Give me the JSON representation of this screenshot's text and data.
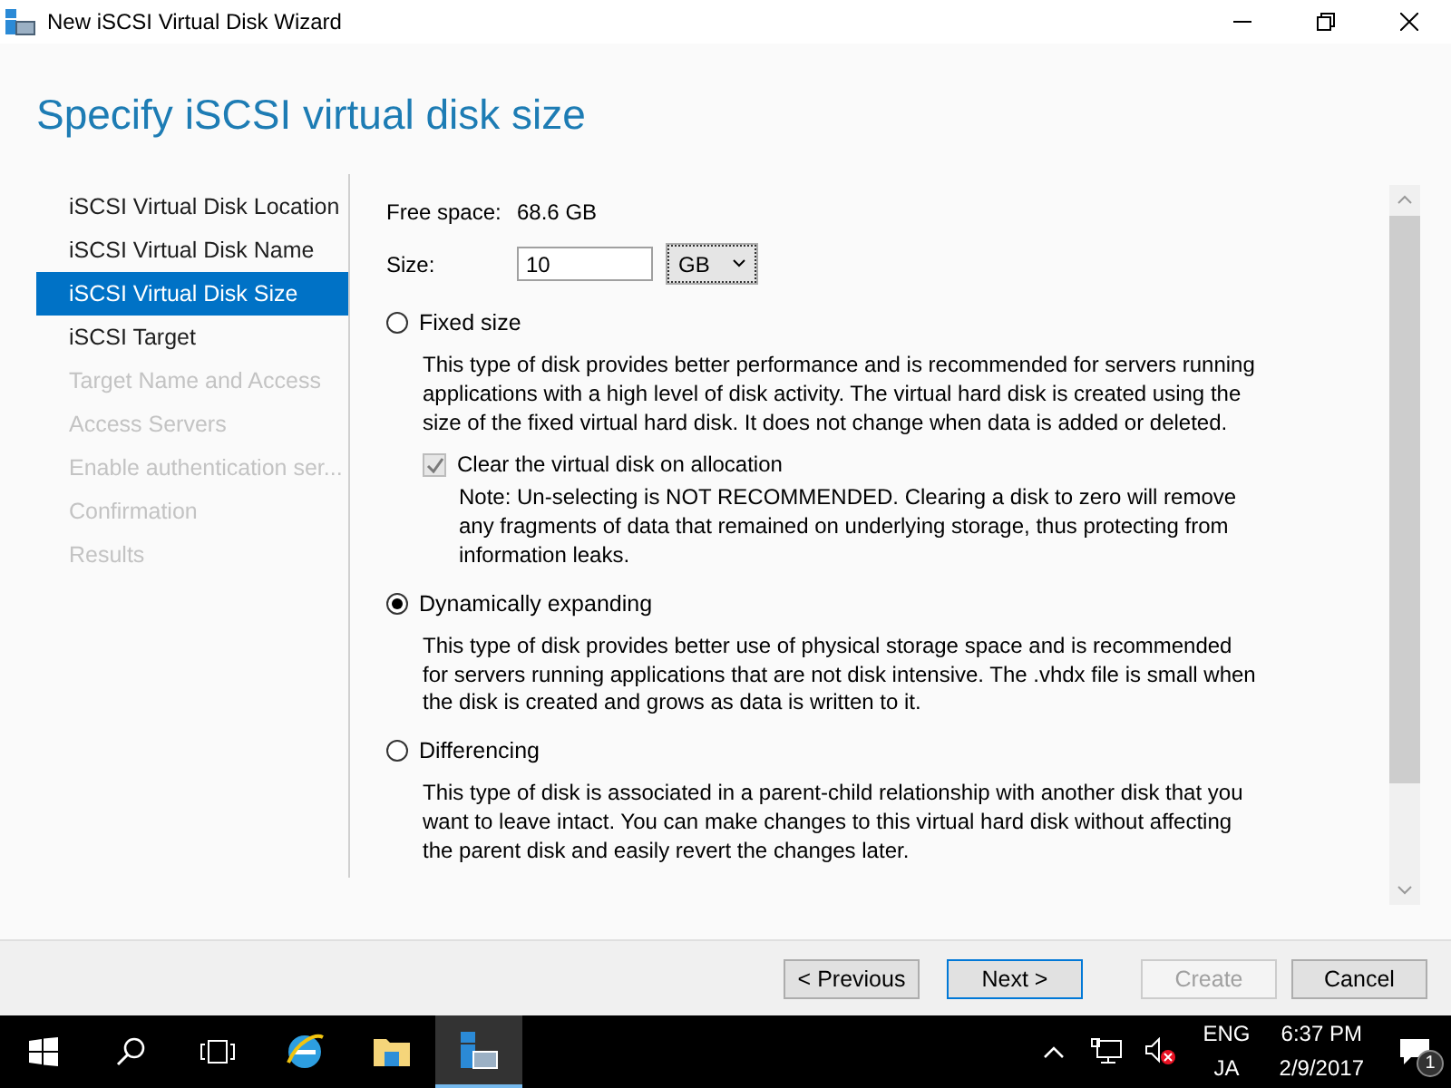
{
  "window": {
    "title": "New iSCSI Virtual Disk Wizard"
  },
  "heading": "Specify iSCSI virtual disk size",
  "steps": [
    {
      "label": "iSCSI Virtual Disk Location",
      "selected": false,
      "disabled": false
    },
    {
      "label": "iSCSI Virtual Disk Name",
      "selected": false,
      "disabled": false
    },
    {
      "label": "iSCSI Virtual Disk Size",
      "selected": true,
      "disabled": false
    },
    {
      "label": "iSCSI Target",
      "selected": false,
      "disabled": false
    },
    {
      "label": "Target Name and Access",
      "selected": false,
      "disabled": true
    },
    {
      "label": "Access Servers",
      "selected": false,
      "disabled": true
    },
    {
      "label": "Enable authentication ser...",
      "selected": false,
      "disabled": true
    },
    {
      "label": "Confirmation",
      "selected": false,
      "disabled": true
    },
    {
      "label": "Results",
      "selected": false,
      "disabled": true
    }
  ],
  "free_space": {
    "label": "Free space:",
    "value": "68.6 GB"
  },
  "size": {
    "label": "Size:",
    "value": "10",
    "unit": "GB"
  },
  "options": [
    {
      "label": "Fixed size",
      "selected": false,
      "description": "This type of disk provides better performance and is recommended for servers running applications with a high level of disk activity. The virtual hard disk is created using the size of the fixed virtual hard disk. It does not change when data is added or deleted.",
      "checkbox": {
        "label": "Clear the virtual disk on allocation",
        "checked": true,
        "disabled": true,
        "note": "Note: Un-selecting is NOT RECOMMENDED. Clearing a disk to zero will remove any fragments of data that remained on underlying storage, thus protecting from information leaks."
      }
    },
    {
      "label": "Dynamically expanding",
      "selected": true,
      "description": "This type of disk provides better use of physical storage space and is recommended for servers running applications that are not disk intensive. The .vhdx file is small when the disk is created and grows as data is written to it."
    },
    {
      "label": "Differencing",
      "selected": false,
      "description": "This type of disk is associated in a parent-child relationship with another disk that you want to leave intact. You can make changes to this virtual hard disk without affecting the parent disk and easily revert the changes later."
    }
  ],
  "buttons": [
    {
      "label": "< Previous",
      "disabled": false,
      "default": false
    },
    {
      "label": "Next >",
      "disabled": false,
      "default": true
    },
    {
      "label": "Create",
      "disabled": true,
      "default": false
    },
    {
      "label": "Cancel",
      "disabled": false,
      "default": false
    }
  ],
  "taskbar": {
    "language": "ENG",
    "input": "JA",
    "time": "6:37 PM",
    "date": "2/9/2017",
    "notifications": "1"
  }
}
